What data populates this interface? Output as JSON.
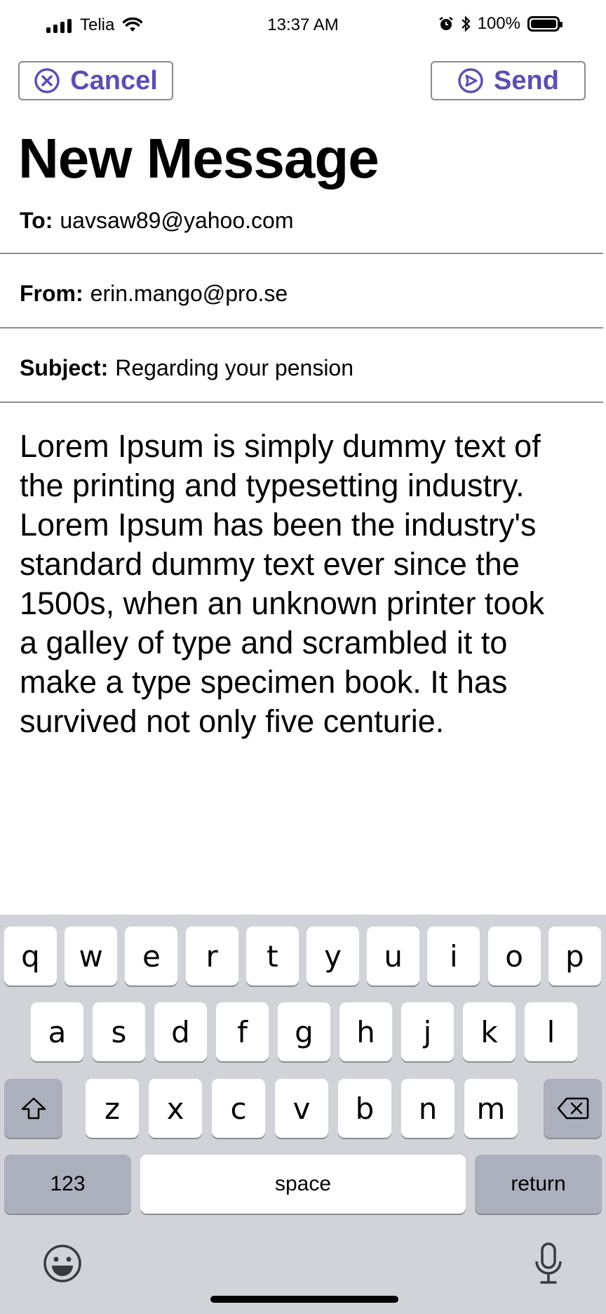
{
  "status_bar": {
    "carrier": "Telia",
    "time": "13:37 AM",
    "battery": "100%"
  },
  "actions": {
    "cancel": "Cancel",
    "send": "Send"
  },
  "title": "New Message",
  "fields": {
    "to_label": "To:",
    "to_value": "uavsaw89@yahoo.com",
    "from_label": "From:",
    "from_value": "erin.mango@pro.se",
    "subject_label": "Subject:",
    "subject_value": "Regarding your pension"
  },
  "body_lines": [
    "Lorem Ipsum is simply dummy text of",
    "the printing and typesetting industry.",
    "Lorem Ipsum has been the industry's",
    "standard dummy text ever since the",
    "1500s, when an unknown printer took",
    "a galley of type and scrambled it to",
    "make a type specimen book. It has",
    "survived not only five centurie."
  ],
  "keyboard": {
    "row1": [
      "q",
      "w",
      "e",
      "r",
      "t",
      "y",
      "u",
      "i",
      "o",
      "p"
    ],
    "row2": [
      "a",
      "s",
      "d",
      "f",
      "g",
      "h",
      "j",
      "k",
      "l"
    ],
    "row3": [
      "z",
      "x",
      "c",
      "v",
      "b",
      "n",
      "m"
    ],
    "numbers": "123",
    "space": "space",
    "return": "return",
    "icons": {
      "shift": "shift-icon",
      "backspace": "backspace-icon",
      "emoji": "emoji-icon",
      "mic": "microphone-icon"
    }
  }
}
